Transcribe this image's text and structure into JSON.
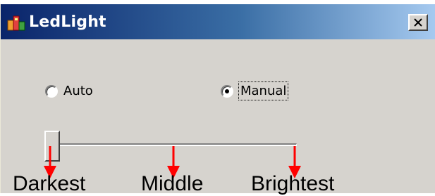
{
  "window": {
    "title": "LedLight",
    "close_glyph": "✕"
  },
  "mode": {
    "options": [
      {
        "label": "Auto",
        "selected": false
      },
      {
        "label": "Manual",
        "selected": true
      }
    ]
  },
  "brightness_slider": {
    "value_fraction": 0
  },
  "annotations": {
    "labels": [
      "Darkest",
      "Middle",
      "Brightest"
    ],
    "arrow_color": "#ff0000"
  },
  "icons": {
    "app": "app-icon",
    "close": "close-icon"
  }
}
